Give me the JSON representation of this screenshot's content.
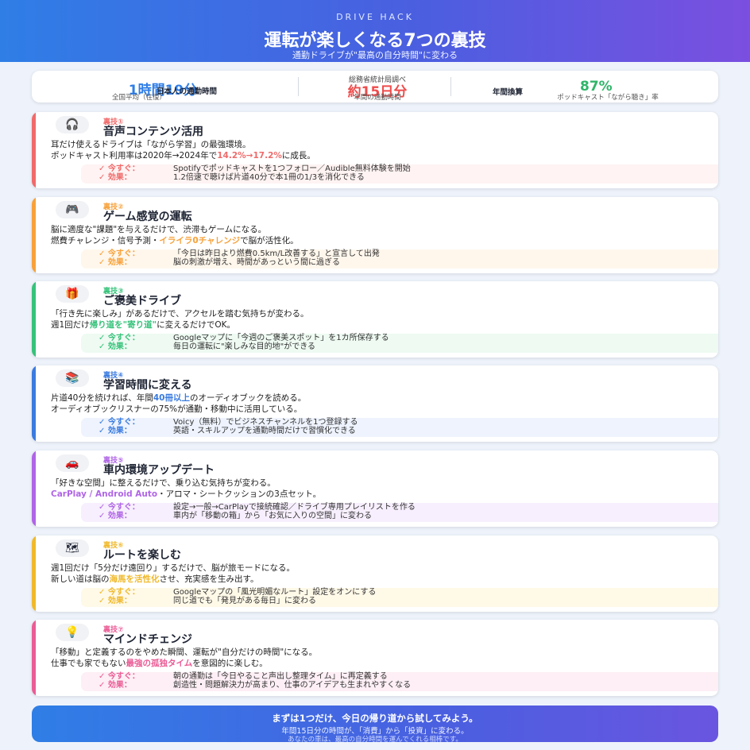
{
  "header": {
    "brand": "DRIVE HACK",
    "title": "運転が楽しくなる7つの裏技",
    "subtitle": "通勤ドライブが\"最高の自分時間\"に変わる"
  },
  "stats": {
    "s1": {
      "big": "1時間19分",
      "label": "日本人の通勤時間",
      "sub": "全国平均（往復）"
    },
    "s2": {
      "src": "総務省統計局調べ",
      "big": "約15日分",
      "label": "年間の",
      "sub": "年間の通勤時間"
    },
    "s3": {
      "label": "年間換算",
      "big": "87%",
      "sub": "ポッドキャスト「ながら聴き」率"
    }
  },
  "colors": {
    "c1": "#f06a6a",
    "c2": "#f7a13a",
    "c3": "#36c27a",
    "c4": "#3a7be0",
    "c5": "#b065e6",
    "c6": "#f0b92c",
    "c7": "#ea5c95"
  },
  "tips": [
    {
      "icon": "headphones-icon",
      "glyph": "🎧",
      "tag": "裏技①",
      "title": "音声コンテンツ活用",
      "line1": "耳だけ使えるドライブは「ながら学習」の最強環境。",
      "line2_pre": "ポッドキャスト利用率は2020年→2024年で",
      "line2_hl": "14.2%→17.2%",
      "line2_post": "に成長。",
      "now_label": "✓ 今すぐ：",
      "now": "Spotifyでポッドキャストを1つフォロー／Audible無料体験を開始",
      "effect_label": "✓ 効果：",
      "effect": "1.2倍速で聴けば片道40分で本1冊の1/3を消化できる"
    },
    {
      "icon": "gamepad-icon",
      "glyph": "🎮",
      "tag": "裏技②",
      "title": "ゲーム感覚の運転",
      "line1": "脳に適度な\"課題\"を与えるだけで、渋滞もゲームになる。",
      "line2_pre": "燃費チャレンジ・信号予測・",
      "line2_hl": "イライラ0チャレンジ",
      "line2_post": "で脳が活性化。",
      "now_label": "✓ 今すぐ：",
      "now": "「今日は昨日より燃費0.5km/L改善する」と宣言して出発",
      "effect_label": "✓ 効果：",
      "effect": "脳の刺激が増え、時間があっという間に過ぎる"
    },
    {
      "icon": "gift-icon",
      "glyph": "🎁",
      "tag": "裏技③",
      "title": "ご褒美ドライブ",
      "line1": "「行き先に楽しみ」があるだけで、アクセルを踏む気持ちが変わる。",
      "line2_pre": "週1回だけ",
      "line2_hl": "帰り道を\"寄り道\"",
      "line2_post": "に変えるだけでOK。",
      "now_label": "✓ 今すぐ：",
      "now": "Googleマップに「今週のご褒美スポット」を1カ所保存する",
      "effect_label": "✓ 効果：",
      "effect": "毎日の運転に\"楽しみな目的地\"ができる"
    },
    {
      "icon": "books-icon",
      "glyph": "📚",
      "tag": "裏技④",
      "title": "学習時間に変える",
      "line1_pre": "片道40分を続ければ、年間",
      "line1_hl": "40冊以上",
      "line1_post": "のオーディオブックを読める。",
      "line2_pre": "オーディオブックリスナーの75%が通勤・移動中に活用している。",
      "line2_hl": "",
      "line2_post": "",
      "now_label": "✓ 今すぐ：",
      "now": "Voicy（無料）でビジネスチャンネルを1つ登録する",
      "effect_label": "✓ 効果：",
      "effect": "英語・スキルアップを通勤時間だけで習慣化できる"
    },
    {
      "icon": "car-icon",
      "glyph": "🚗",
      "tag": "裏技⑤",
      "title": "車内環境アップデート",
      "line1": "「好きな空間」に整えるだけで、乗り込む気持ちが変わる。",
      "line2_pre": "",
      "line2_hl": "CarPlay / Android Auto",
      "line2_post": "・アロマ・シートクッションの3点セット。",
      "now_label": "✓ 今すぐ：",
      "now": "設定→一般→CarPlayで接続確認／ドライブ専用プレイリストを作る",
      "effect_label": "✓ 効果：",
      "effect": "車内が「移動の箱」から「お気に入りの空間」に変わる"
    },
    {
      "icon": "map-icon",
      "glyph": "🗺",
      "tag": "裏技⑥",
      "title": "ルートを楽しむ",
      "line1": "週1回だけ「5分だけ遠回り」するだけで、脳が旅モードになる。",
      "line2_pre": "新しい道は脳の",
      "line2_hl": "海馬を活性化",
      "line2_post": "させ、充実感を生み出す。",
      "now_label": "✓ 今すぐ：",
      "now": "Googleマップの「風光明媚なルート」設定をオンにする",
      "effect_label": "✓ 効果：",
      "effect": "同じ道でも「発見がある毎日」に変わる"
    },
    {
      "icon": "lightbulb-icon",
      "glyph": "💡",
      "tag": "裏技⑦",
      "title": "マインドチェンジ",
      "line1": "「移動」と定義するのをやめた瞬間、運転が\"自分だけの時間\"になる。",
      "line2_pre": "仕事でも家でもない",
      "line2_hl": "最強の孤独タイム",
      "line2_post": "を意図的に楽しむ。",
      "now_label": "✓ 今すぐ：",
      "now": "朝の通勤は「今日やること声出し整理タイム」に再定義する",
      "effect_label": "✓ 効果：",
      "effect": "創造性・問題解決力が高まり、仕事のアイデアも生まれやすくなる"
    }
  ],
  "footer": {
    "line1": "まずは1つだけ、今日の帰り道から試してみよう。",
    "line2": "年間15日分の時間が、「消費」から「投資」に変わる。",
    "line3": "あなたの車は、最高の自分時間を運んでくれる相棒です。"
  }
}
